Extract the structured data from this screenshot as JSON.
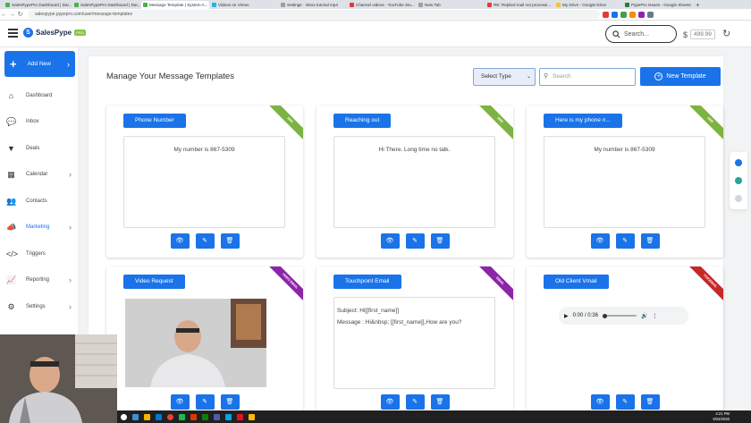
{
  "browser": {
    "tabs": [
      {
        "label": "SalesPypePro Dashboard | Dar...",
        "color": "#4caf50",
        "active": false
      },
      {
        "label": "SalesPypePro Dashboard | Dar...",
        "color": "#4caf50",
        "active": false
      },
      {
        "label": "Message Template | System A...",
        "color": "#4caf50",
        "active": true
      },
      {
        "label": "Videos on Vimeo",
        "color": "#1ab7ea",
        "active": false
      },
      {
        "label": "Settings · inbox tutorial mp4",
        "color": "#9e9e9e",
        "active": false
      },
      {
        "label": "Channel videos - YouTube Stu...",
        "color": "#e53935",
        "active": false
      },
      {
        "label": "New Tab",
        "color": "#9e9e9e",
        "active": false
      },
      {
        "label": "RE: Replied mail not processi...",
        "color": "#e53935",
        "active": false
      },
      {
        "label": "My Drive - Google Drive",
        "color": "#fbc02d",
        "active": false
      },
      {
        "label": "PypePro Issues - Google Sheets",
        "color": "#2e7d32",
        "active": false
      }
    ],
    "new_tab_label": "+",
    "url": "salespype.pypepro.com/user/message-templates"
  },
  "header": {
    "logo_mark": "S",
    "logo_text": "SalesPype",
    "logo_badge": "PRO",
    "search_placeholder": "Search...",
    "balance_symbol": "$",
    "balance_value": "499.99"
  },
  "sidebar": {
    "add_new_label": "Add New",
    "items": [
      {
        "label": "Dashboard",
        "icon": "home-icon",
        "glyph": "⌂",
        "chevron": false,
        "active": false
      },
      {
        "label": "Inbox",
        "icon": "chat-icon",
        "glyph": "💬",
        "chevron": false,
        "active": false
      },
      {
        "label": "Deals",
        "icon": "filter-icon",
        "glyph": "▼",
        "chevron": false,
        "active": false
      },
      {
        "label": "Calendar",
        "icon": "calendar-icon",
        "glyph": "▦",
        "chevron": true,
        "active": false
      },
      {
        "label": "Contacts",
        "icon": "contacts-icon",
        "glyph": "👥",
        "chevron": false,
        "active": false
      },
      {
        "label": "Marketing",
        "icon": "megaphone-icon",
        "glyph": "📣",
        "chevron": true,
        "active": true
      },
      {
        "label": "Triggers",
        "icon": "code-icon",
        "glyph": "</>",
        "chevron": false,
        "active": false
      },
      {
        "label": "Reporting",
        "icon": "chart-icon",
        "glyph": "📈",
        "chevron": true,
        "active": false
      },
      {
        "label": "Settings",
        "icon": "gears-icon",
        "glyph": "⚙",
        "chevron": true,
        "active": false
      }
    ]
  },
  "main": {
    "title": "Manage Your Message Templates",
    "select_type_label": "Select Type",
    "search_placeholder": "Search",
    "new_template_label": "New Template",
    "cards": [
      {
        "label": "Phone Number",
        "ribbon": "SMS",
        "ribbon_class": "sms",
        "kind": "text",
        "lines": [
          "My number is 867-5309"
        ]
      },
      {
        "label": "Reaching out",
        "ribbon": "SMS",
        "ribbon_class": "sms",
        "kind": "text",
        "lines": [
          "Hi There. Long time no talk."
        ]
      },
      {
        "label": "Here is my phone n...",
        "ribbon": "SMS",
        "ribbon_class": "sms",
        "kind": "text",
        "lines": [
          "My number is 867-5309"
        ]
      },
      {
        "label": "Video Request",
        "ribbon": "VIDEO EMAIL",
        "ribbon_class": "video",
        "kind": "video",
        "lines": []
      },
      {
        "label": "Touchpoint Email",
        "ribbon": "EMAIL",
        "ribbon_class": "email",
        "kind": "email",
        "lines": [
          "Subject: Hi[[first_name]]",
          "Message : Hi&nbsp; [[first_name]],How are you?"
        ]
      },
      {
        "label": "Old Client Vmail",
        "ribbon": "VOICEMAIL",
        "ribbon_class": "vm",
        "kind": "audio",
        "lines": [],
        "audio_time": "0:00 / 0:36"
      }
    ]
  },
  "taskbar": {
    "time": "4:21 PM",
    "date": "9/23/2020"
  }
}
